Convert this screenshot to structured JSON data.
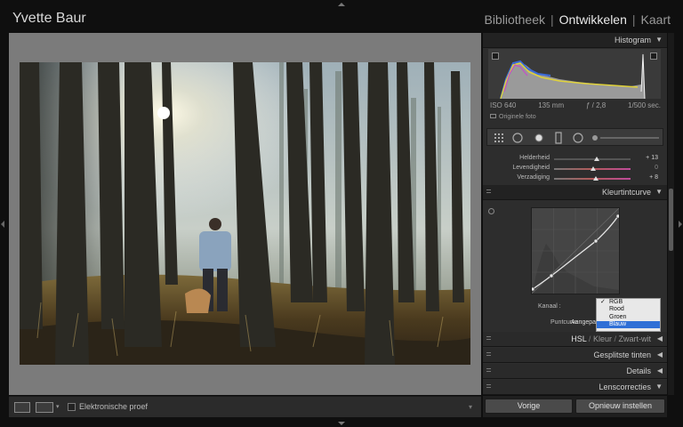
{
  "header": {
    "identity_plate": "Yvette Baur",
    "modules": [
      {
        "label": "Bibliotheek",
        "active": false
      },
      {
        "label": "Ontwikkelen",
        "active": true
      },
      {
        "label": "Kaart",
        "active": false
      }
    ],
    "separator": "|"
  },
  "toolbar": {
    "soft_proof_label": "Elektronische proef",
    "view_icons": [
      "loupe-view-icon",
      "before-after-icon"
    ]
  },
  "panels": {
    "histogram": {
      "title": "Histogram",
      "iso": "ISO 640",
      "focal": "135 mm",
      "aperture": "ƒ / 2,8",
      "shutter": "1/500 sec.",
      "original_photo": "Originele foto"
    },
    "color_sliders": [
      {
        "label": "Helderheid",
        "value": "+ 13"
      },
      {
        "label": "Levendigheid",
        "value": "0"
      },
      {
        "label": "Verzadiging",
        "value": "+ 8"
      }
    ],
    "tone_curve": {
      "title": "Kleurtintcurve",
      "channel_label": "Kanaal :",
      "point_curve_label": "Puntcurve :",
      "point_curve_value": "Aangepast",
      "channel_options": [
        "RGB",
        "Rood",
        "Groen",
        "Blauw"
      ],
      "checked_option": "RGB",
      "highlighted_option": "Blauw"
    },
    "hsl": {
      "items": [
        "HSL",
        "Kleur",
        "Zwart-wit"
      ],
      "separator": "/"
    },
    "split_toning": {
      "title": "Gesplitste tinten"
    },
    "details": {
      "title": "Details"
    },
    "lens": {
      "title": "Lenscorrecties"
    }
  },
  "buttons": {
    "previous": "Vorige",
    "reset": "Opnieuw instellen"
  },
  "colors": {
    "highlight": "#2f6fd6",
    "panel_bg": "#2d2d2d",
    "canvas_bg": "#7b7b7b"
  }
}
